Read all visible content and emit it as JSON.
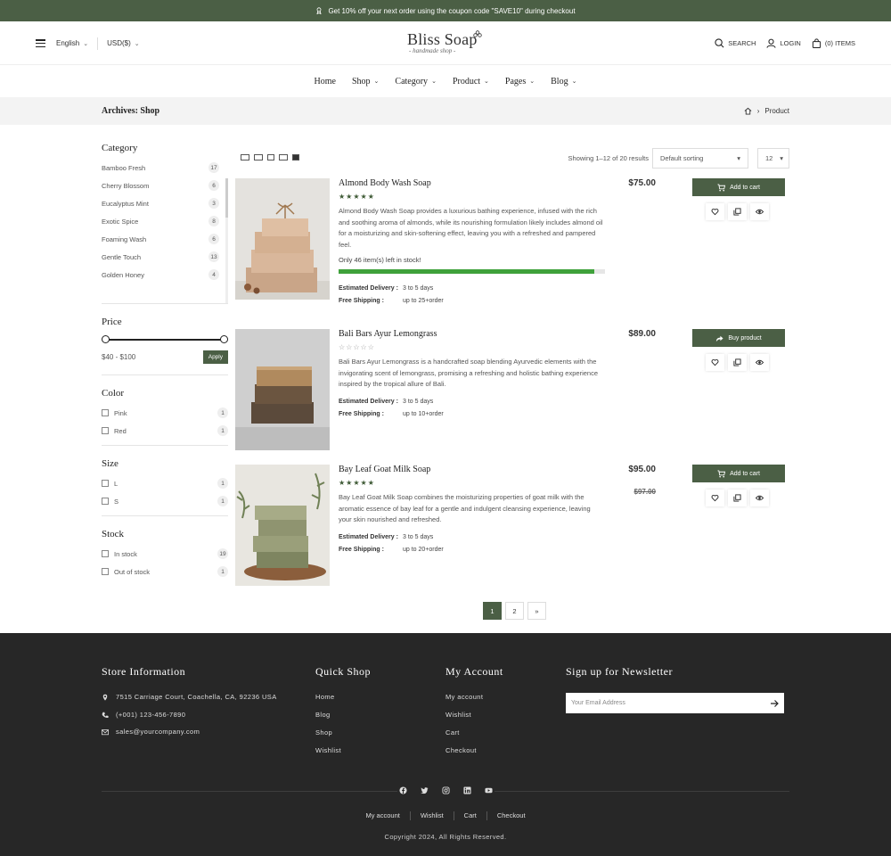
{
  "topbar": {
    "promo": "Get 10% off your next order using the coupon code \"SAVE10\" during checkout"
  },
  "header": {
    "language": "English",
    "currency": "USD($)",
    "logo": {
      "name": "Bliss Soap",
      "tagline": "- handmade shop -"
    },
    "search_label": "SEARCH",
    "login_label": "LOGIN",
    "cart_label": "(0) ITEMS"
  },
  "nav": {
    "items": [
      {
        "label": "Home"
      },
      {
        "label": "Shop"
      },
      {
        "label": "Category"
      },
      {
        "label": "Product"
      },
      {
        "label": "Pages"
      },
      {
        "label": "Blog"
      }
    ]
  },
  "page": {
    "title": "Archives: Shop",
    "crumb": "Product"
  },
  "sidebar": {
    "category_title": "Category",
    "categories": [
      {
        "name": "Bamboo Fresh",
        "count": "17"
      },
      {
        "name": "Cherry Blossom",
        "count": "6"
      },
      {
        "name": "Eucalyptus Mint",
        "count": "3"
      },
      {
        "name": "Exotic Spice",
        "count": "8"
      },
      {
        "name": "Foaming Wash",
        "count": "6"
      },
      {
        "name": "Gentle Touch",
        "count": "13"
      },
      {
        "name": "Golden Honey",
        "count": "4"
      }
    ],
    "price_title": "Price",
    "price_range": "$40 - $100",
    "apply_label": "Apply",
    "color_title": "Color",
    "colors": [
      {
        "name": "Pink",
        "count": "1"
      },
      {
        "name": "Red",
        "count": "1"
      }
    ],
    "size_title": "Size",
    "sizes": [
      {
        "name": "L",
        "count": "1"
      },
      {
        "name": "S",
        "count": "1"
      }
    ],
    "stock_title": "Stock",
    "stock": [
      {
        "name": "In stock",
        "count": "19"
      },
      {
        "name": "Out of stock",
        "count": "1"
      }
    ]
  },
  "toolbar": {
    "showing": "Showing 1–12 of 20 results",
    "sort": "Default sorting",
    "per_page": "12"
  },
  "products": [
    {
      "name": "Almond Body Wash Soap",
      "rating": 5,
      "description": "Almond Body Wash Soap provides a luxurious bathing experience, infused with the rich and soothing aroma of almonds, while its nourishing formulation likely includes almond oil for a moisturizing and skin-softening effect, leaving you with a refreshed and pampered feel.",
      "stock_text": "Only 46 item(s) left in stock!",
      "stock_fraction": 0.96,
      "delivery_label": "Estimated Delivery :",
      "delivery": "3 to 5 days",
      "shipping_label": "Free Shipping :",
      "shipping": "up to 25+order",
      "price": "$75.00",
      "old_price": "",
      "button": "Add to cart",
      "colors": {
        "bg": "#e4e2de",
        "soap": "#d9b79b",
        "soap_dark": "#c9a588"
      }
    },
    {
      "name": "Bali Bars Ayur Lemongrass",
      "rating": 0,
      "description": "Bali Bars Ayur Lemongrass is a handcrafted soap blending Ayurvedic elements with the invigorating scent of lemongrass, promising a refreshing and holistic bathing experience inspired by the tropical allure of Bali.",
      "delivery_label": "Estimated Delivery :",
      "delivery": "3 to 5 days",
      "shipping_label": "Free Shipping :",
      "shipping": "up to 10+order",
      "price": "$89.00",
      "old_price": "",
      "button": "Buy product",
      "colors": {
        "bg": "#cfcfcf",
        "soap": "#b08a5e",
        "soap_dark": "#5b4a3b"
      }
    },
    {
      "name": "Bay Leaf Goat Milk Soap",
      "rating": 5,
      "description": "Bay Leaf Goat Milk Soap combines the moisturizing properties of goat milk with the aromatic essence of bay leaf for a gentle and indulgent cleansing experience, leaving your skin nourished and refreshed.",
      "delivery_label": "Estimated Delivery :",
      "delivery": "3 to 5 days",
      "shipping_label": "Free Shipping :",
      "shipping": "up to 20+order",
      "price": "$95.00",
      "old_price": "$97.00",
      "button": "Add to cart",
      "colors": {
        "bg": "#e8e6e0",
        "soap": "#9a9f7a",
        "soap_dark": "#7e8560"
      }
    }
  ],
  "pagination": {
    "pages": [
      "1",
      "2"
    ],
    "next": "»"
  },
  "footer": {
    "store_title": "Store Information",
    "address": "7515 Carriage Court, Coachella, CA, 92236 USA",
    "phone": "(+001) 123-456-7890",
    "email": "sales@yourcompany.com",
    "quick_title": "Quick Shop",
    "quick_links": [
      "Home",
      "Blog",
      "Shop",
      "Wishlist"
    ],
    "account_title": "My Account",
    "account_links": [
      "My account",
      "Wishlist",
      "Cart",
      "Checkout"
    ],
    "newsletter_title": "Sign up for Newsletter",
    "newsletter_placeholder": "Your Email Address",
    "bottom_links": [
      "My account",
      "Wishlist",
      "Cart",
      "Checkout"
    ],
    "copyright": "Copyright 2024, All Rights Reserved."
  },
  "icons": [
    "ribbon-icon",
    "menu-icon",
    "search-icon",
    "user-icon",
    "bag-icon",
    "home-icon",
    "cart-icon",
    "share-icon",
    "heart-icon",
    "compare-icon",
    "eye-icon",
    "location-icon",
    "phone-icon",
    "mail-icon",
    "arrow-right-icon",
    "facebook-icon",
    "twitter-icon",
    "instagram-icon",
    "linkedin-icon",
    "youtube-icon"
  ],
  "theme": {
    "accent": "#4b5f45",
    "footer_bg": "#272727",
    "stock_bar": "#3fa13b"
  }
}
